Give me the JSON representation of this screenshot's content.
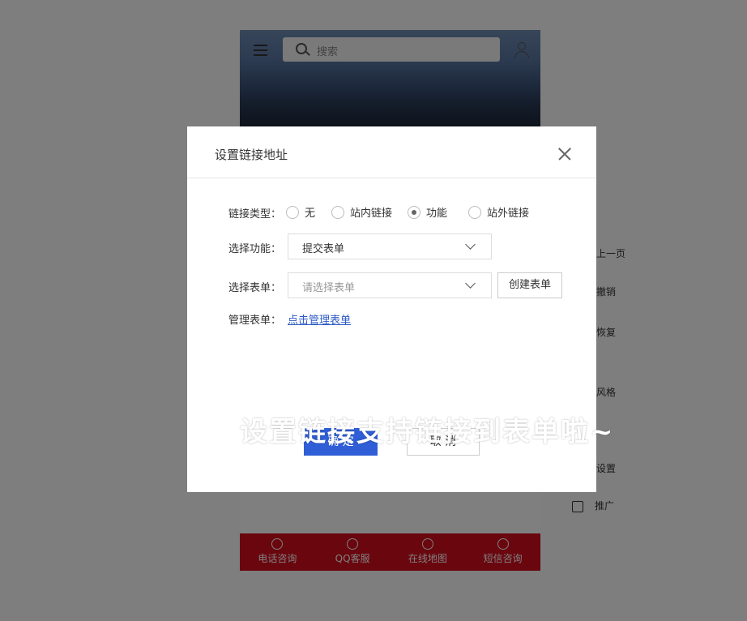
{
  "background": {
    "search_placeholder": "搜索",
    "footer": [
      "电话咨询",
      "QQ客服",
      "在线地图",
      "短信咨询"
    ],
    "side_items": [
      "上一页",
      "撤销",
      "恢复",
      "风格",
      "设置",
      "推广"
    ]
  },
  "dialog": {
    "title": "设置链接地址",
    "link_type_label": "链接类型：",
    "link_types": [
      {
        "label": "无",
        "checked": false
      },
      {
        "label": "站内链接",
        "checked": false
      },
      {
        "label": "功能",
        "checked": true
      },
      {
        "label": "站外链接",
        "checked": false
      }
    ],
    "function_label": "选择功能：",
    "function_value": "提交表单",
    "form_label": "选择表单：",
    "form_placeholder": "请选择表单",
    "create_form_button": "创建表单",
    "manage_label": "管理表单：",
    "manage_link": "点击管理表单",
    "ok_button": "确 定",
    "cancel_button": "取 消"
  },
  "annotation": {
    "text": "设置链接支持链接到表单啦~"
  },
  "colors": {
    "primary": "#2f5ed6",
    "footer_red": "#d40d1c",
    "link": "#2c5ac7"
  }
}
